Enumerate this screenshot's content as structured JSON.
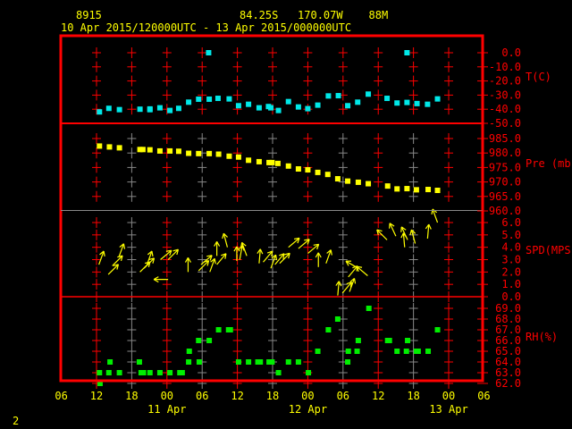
{
  "header": {
    "station": "8915",
    "location": "84.25S   170.07W    88M",
    "period": "10 Apr 2015/120000UTC - 13 Apr 2015/000000UTC"
  },
  "footer_number": "2",
  "colors": {
    "frame": "#ff0000",
    "temp": "#00e8e8",
    "pressure": "#ffff00",
    "wind": "#ffff00",
    "rh": "#00ee00",
    "grid_alt": "#888888",
    "text": "#ffff00"
  },
  "chart_data": {
    "type": "scatter",
    "title": "8915  84.25S 170.07W 88M",
    "xlabel": "",
    "x_units": "hours since 10 Apr 2015 12Z",
    "xlim": [
      -6,
      66
    ],
    "x_tick_labels": [
      "06",
      "12",
      "18",
      "00",
      "06",
      "12",
      "18",
      "00",
      "06",
      "12",
      "18",
      "00",
      "06"
    ],
    "date_labels": [
      {
        "label": "11 Apr",
        "hour": 12
      },
      {
        "label": "12 Apr",
        "hour": 36
      },
      {
        "label": "13 Apr",
        "hour": 60
      }
    ],
    "panels": [
      {
        "name": "temperature",
        "ylabel": "T(C)",
        "ylim": [
          -50,
          0
        ],
        "tick_labels": [
          "0.0",
          "-10.0",
          "-20.0",
          "-30.0",
          "-40.0",
          "-50.0"
        ],
        "tick_values": [
          0,
          -10,
          -20,
          -30,
          -40,
          -50
        ],
        "points": [
          [
            0.5,
            -41.9
          ],
          [
            2.1,
            -39.4
          ],
          [
            3.9,
            -40.3
          ],
          [
            7.4,
            -40
          ],
          [
            9.1,
            -40.3
          ],
          [
            9.1,
            -39.8
          ],
          [
            10.8,
            -39
          ],
          [
            12.5,
            -40.9
          ],
          [
            14,
            -39.4
          ],
          [
            15.7,
            -35
          ],
          [
            17.4,
            -32.9
          ],
          [
            19.2,
            -32.9
          ],
          [
            20.7,
            -32.3
          ],
          [
            22.6,
            -32.7
          ],
          [
            24.2,
            -37.5
          ],
          [
            25.9,
            -36.5
          ],
          [
            27.7,
            -39
          ],
          [
            29.3,
            -38.1
          ],
          [
            29.7,
            -39
          ],
          [
            31,
            -40.9
          ],
          [
            32.7,
            -34.6
          ],
          [
            34.4,
            -38.4
          ],
          [
            36,
            -39.6
          ],
          [
            37.7,
            -37.1
          ],
          [
            39.5,
            -30.6
          ],
          [
            41.2,
            -30.4
          ],
          [
            42.8,
            -37.5
          ],
          [
            44.5,
            -35
          ],
          [
            46.3,
            -29.3
          ],
          [
            49.5,
            -32.3
          ],
          [
            51.2,
            -35.6
          ],
          [
            52.9,
            -35.2
          ],
          [
            54.6,
            -36
          ],
          [
            56.4,
            -36.5
          ],
          [
            58.1,
            -32.7
          ],
          [
            19.1,
            0
          ],
          [
            52.9,
            0
          ]
        ]
      },
      {
        "name": "pressure",
        "ylabel": "Pre (mb)",
        "ylim": [
          960,
          985
        ],
        "tick_labels": [
          "985.0",
          "980.0",
          "975.0",
          "970.0",
          "965.0",
          "960.0"
        ],
        "tick_values": [
          985,
          980,
          975,
          970,
          965,
          960
        ],
        "points": [
          [
            0.5,
            982.4
          ],
          [
            2.2,
            982.1
          ],
          [
            3.9,
            981.8
          ],
          [
            7.4,
            981.2
          ],
          [
            7.9,
            981.2
          ],
          [
            9.1,
            981.1
          ],
          [
            10.8,
            980.7
          ],
          [
            12.5,
            980.7
          ],
          [
            14,
            980.6
          ],
          [
            15.7,
            979.9
          ],
          [
            17.4,
            979.8
          ],
          [
            19.2,
            979.8
          ],
          [
            20.8,
            979.6
          ],
          [
            22.6,
            978.9
          ],
          [
            24.2,
            978.6
          ],
          [
            25.9,
            977.5
          ],
          [
            27.7,
            977
          ],
          [
            29.4,
            976.7
          ],
          [
            29.9,
            976.7
          ],
          [
            30.9,
            976.4
          ],
          [
            32.7,
            975.5
          ],
          [
            34.4,
            974.5
          ],
          [
            36,
            974.2
          ],
          [
            37.7,
            973.3
          ],
          [
            39.4,
            972.6
          ],
          [
            41.1,
            971.1
          ],
          [
            42.8,
            970.3
          ],
          [
            44.6,
            969.9
          ],
          [
            46.3,
            969.4
          ],
          [
            49.6,
            968.6
          ],
          [
            51.2,
            967.6
          ],
          [
            52.9,
            967.7
          ],
          [
            54.5,
            967.3
          ],
          [
            56.5,
            967.4
          ],
          [
            58.1,
            967.1
          ]
        ]
      },
      {
        "name": "wind_speed",
        "ylabel": "SPD(MPS)",
        "ylim": [
          0,
          6
        ],
        "tick_labels": [
          "6.0",
          "5.0",
          "4.0",
          "3.0",
          "2.0",
          "1.0",
          "0.0"
        ],
        "tick_values": [
          6,
          5,
          4,
          3,
          2,
          1,
          0
        ],
        "points_hour_speed_direction": [
          [
            0.4,
            2.6,
            20
          ],
          [
            2.0,
            1.8,
            45
          ],
          [
            2.7,
            2.5,
            45
          ],
          [
            3.8,
            3.2,
            20
          ],
          [
            7.4,
            2.0,
            45
          ],
          [
            8.1,
            2.3,
            45
          ],
          [
            8.6,
            2.6,
            20
          ],
          [
            10.9,
            3.0,
            50
          ],
          [
            12.2,
            3.0,
            45
          ],
          [
            12.2,
            1.4,
            -90
          ],
          [
            15.6,
            2.0,
            0
          ],
          [
            17.4,
            2.1,
            45
          ],
          [
            17.8,
            2.6,
            50
          ],
          [
            19.3,
            2.0,
            20
          ],
          [
            20.5,
            2.6,
            40
          ],
          [
            20.5,
            3.3,
            0
          ],
          [
            22.3,
            4.0,
            -15
          ],
          [
            23.9,
            2.9,
            0
          ],
          [
            24.4,
            3.0,
            10
          ],
          [
            25.6,
            3.3,
            -20
          ],
          [
            27.7,
            2.7,
            5
          ],
          [
            28.4,
            2.8,
            40
          ],
          [
            29.7,
            2.3,
            20
          ],
          [
            30.4,
            2.6,
            40
          ],
          [
            31.2,
            2.7,
            45
          ],
          [
            32.7,
            4.0,
            50
          ],
          [
            34.4,
            3.9,
            50
          ],
          [
            36.0,
            3.5,
            50
          ],
          [
            37.8,
            2.4,
            0
          ],
          [
            39.1,
            2.7,
            20
          ],
          [
            41.1,
            0.1,
            5
          ],
          [
            41.9,
            0.3,
            40
          ],
          [
            43.1,
            0.4,
            20
          ],
          [
            42.9,
            1.6,
            40
          ],
          [
            44.6,
            2.3,
            -60
          ],
          [
            46.2,
            1.7,
            -50
          ],
          [
            49.5,
            4.6,
            -45
          ],
          [
            51.0,
            4.9,
            -25
          ],
          [
            52.5,
            4.0,
            -5
          ],
          [
            53.0,
            4.6,
            -25
          ],
          [
            54.3,
            4.3,
            -15
          ],
          [
            56.4,
            4.7,
            5
          ],
          [
            58.1,
            6.0,
            -20
          ]
        ]
      },
      {
        "name": "relative_humidity",
        "ylabel": "RH(%)",
        "ylim": [
          62,
          69
        ],
        "tick_labels": [
          "69.0",
          "68.0",
          "67.0",
          "66.0",
          "65.0",
          "64.0",
          "63.0",
          "62.0"
        ],
        "tick_values": [
          69,
          68,
          67,
          66,
          65,
          64,
          63,
          62
        ],
        "points": [
          [
            0.5,
            63
          ],
          [
            0.6,
            62
          ],
          [
            2.3,
            64
          ],
          [
            2.1,
            63
          ],
          [
            3.9,
            63
          ],
          [
            7.3,
            64
          ],
          [
            7.6,
            63
          ],
          [
            8.0,
            63
          ],
          [
            9.1,
            63
          ],
          [
            10.8,
            63
          ],
          [
            12.5,
            63
          ],
          [
            14.2,
            63
          ],
          [
            14.6,
            63
          ],
          [
            15.7,
            64
          ],
          [
            15.8,
            65
          ],
          [
            17.4,
            66
          ],
          [
            17.5,
            64
          ],
          [
            19.2,
            66
          ],
          [
            20.8,
            67
          ],
          [
            22.5,
            67
          ],
          [
            22.8,
            67
          ],
          [
            24.2,
            64
          ],
          [
            25.9,
            64
          ],
          [
            27.5,
            64
          ],
          [
            27.9,
            64
          ],
          [
            29.4,
            64
          ],
          [
            29.9,
            64
          ],
          [
            31,
            63
          ],
          [
            32.7,
            64
          ],
          [
            34.4,
            64
          ],
          [
            36.1,
            63
          ],
          [
            37.7,
            65
          ],
          [
            39.5,
            67
          ],
          [
            41.1,
            68
          ],
          [
            42.8,
            64
          ],
          [
            42.9,
            65
          ],
          [
            44.4,
            65
          ],
          [
            44.6,
            66
          ],
          [
            46.4,
            69
          ],
          [
            49.6,
            66
          ],
          [
            49.9,
            66
          ],
          [
            51.2,
            65
          ],
          [
            52.8,
            65
          ],
          [
            53,
            66
          ],
          [
            54.5,
            65
          ],
          [
            54.8,
            65
          ],
          [
            56.5,
            65
          ],
          [
            58.1,
            67
          ]
        ]
      }
    ]
  }
}
